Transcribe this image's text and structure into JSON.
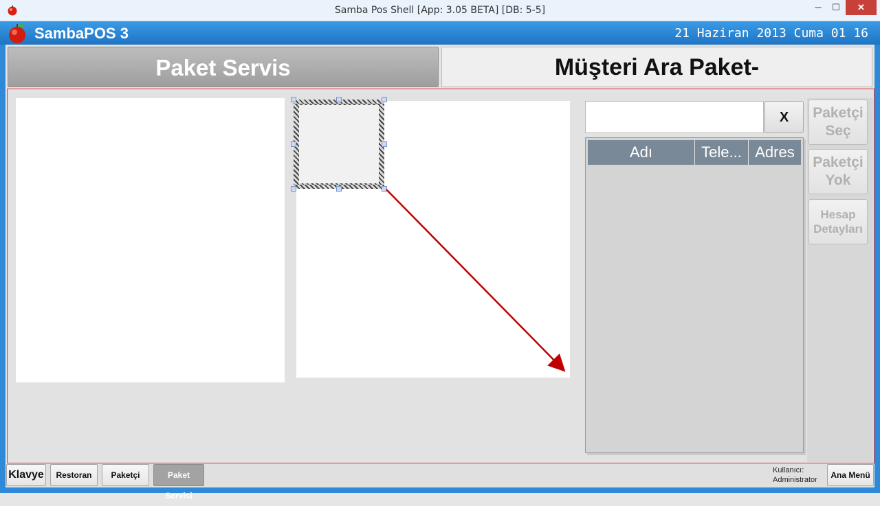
{
  "window": {
    "title": "Samba Pos Shell [App: 3.05 BETA] [DB: 5-5]",
    "controls": {
      "minimize": "─",
      "maximize": "☐",
      "close": "✕"
    }
  },
  "header": {
    "brand": "SambaPOS 3",
    "datetime": "21 Haziran 2013 Cuma 01 16"
  },
  "tabs": {
    "left": "Paket Servis",
    "right": "Müşteri Ara Paket-"
  },
  "search": {
    "value": "",
    "placeholder": "",
    "clear_label": "X"
  },
  "grid": {
    "columns": [
      "Adı",
      "Tele...",
      "Adres"
    ],
    "rows": []
  },
  "side_buttons": {
    "select_courier": "Paketçi Seç",
    "no_courier": "Paketçi Yok",
    "account_details": "Hesap Detayları"
  },
  "bottom": {
    "keyboard": "Klavye",
    "restaurant": "Restoran",
    "courier": "Paketçi",
    "delivery": "Paket Servisi",
    "user_label": "Kullanıcı:",
    "user_name": "Administrator",
    "main_menu": "Ana Menü"
  },
  "colors": {
    "header_blue": "#2e8ad8",
    "content_border": "#dd3333",
    "arrow": "#c00000",
    "grid_header": "#7a8997"
  }
}
